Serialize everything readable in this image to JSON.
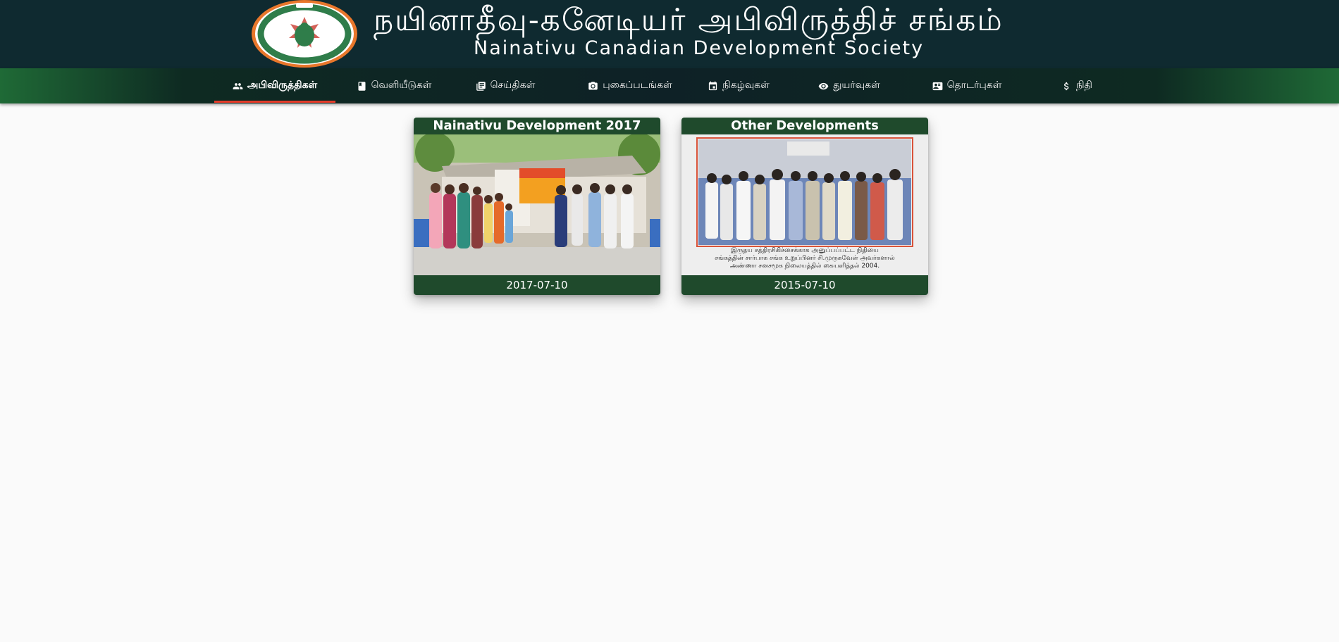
{
  "header": {
    "title_tamil": "நயினாதீவு-கனேடியர் அபிவிருத்திச் சங்கம்",
    "title_english": "Nainativu Canadian Development Society"
  },
  "nav": {
    "items": [
      {
        "label": "அபிவிருத்திகள்",
        "icon": "people-icon",
        "active": true
      },
      {
        "label": "வெளியீடுகள்",
        "icon": "book-icon",
        "active": false
      },
      {
        "label": "செய்திகள்",
        "icon": "news-icon",
        "active": false
      },
      {
        "label": "புகைப்படங்கள்",
        "icon": "camera-icon",
        "active": false
      },
      {
        "label": "நிகழ்வுகள்",
        "icon": "calendar-icon",
        "active": false
      },
      {
        "label": "துயர்வுகள்",
        "icon": "eye-icon",
        "active": false
      },
      {
        "label": "தொடர்புகள்",
        "icon": "contact-card-icon",
        "active": false
      },
      {
        "label": "நிதி",
        "icon": "dollar-icon",
        "active": false
      }
    ]
  },
  "cards": [
    {
      "title": "Nainativu Development 2017",
      "date": "2017-07-10"
    },
    {
      "title": "Other Developments",
      "date": "2015-07-10",
      "caption_lines": [
        "இருதய சத்திரசிகிச்சைக்காக அனுப்பப்பட்ட நிதியை",
        "சங்கத்தின் சார்பாக சங்க உறுப்பினர் சி.முருகவேள் அவர்களால்",
        "அண்ணா சனசமூக நிலையத்தில் கையளித்தல் 2004."
      ]
    }
  ],
  "colors": {
    "banner": "#0f2a30",
    "nav_green": "#1f6a36",
    "active_underline": "#e53c2b",
    "card_green": "#1f4a2c",
    "page_bg": "#fafafa"
  }
}
